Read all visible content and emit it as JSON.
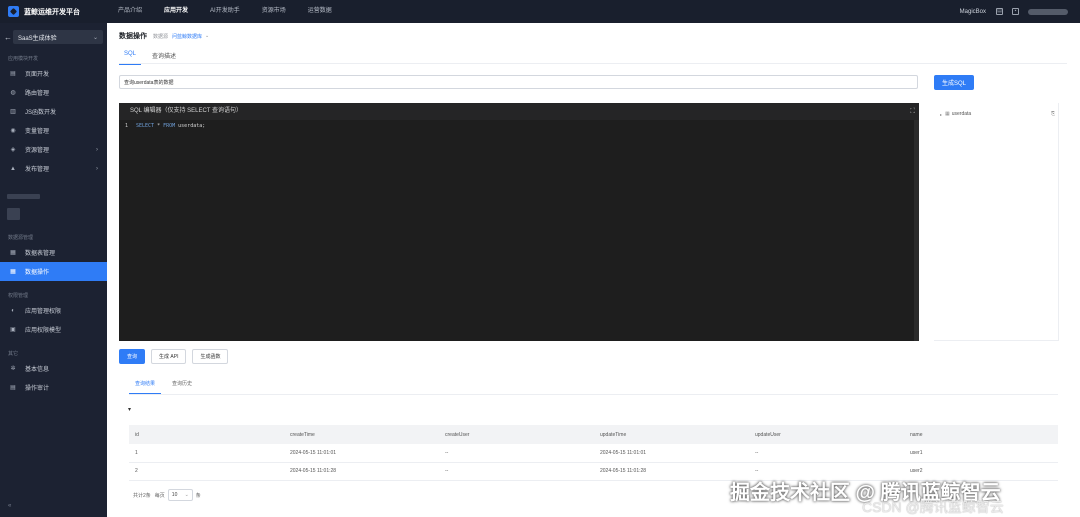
{
  "topbar": {
    "logo_text": "蓝鲸运维开发平台",
    "nav": [
      "产品介绍",
      "应用开发",
      "AI开发助手",
      "资源市场",
      "运营数据"
    ],
    "active_nav": 1,
    "brand": "MagicBox"
  },
  "sidebar": {
    "app_name": "SaaS生成体验",
    "group1_title": "应用模块开发",
    "group1_items": [
      "页面开发",
      "路由管理",
      "JS函数开发",
      "变量管理",
      "资源管理",
      "发布管理"
    ],
    "group2_title": "数据源管理",
    "group2_items": [
      "数据表管理",
      "数据操作"
    ],
    "group3_title": "权限管理",
    "group3_items": [
      "应用管理权限",
      "应用权限模型"
    ],
    "group4_title": "其它",
    "group4_items": [
      "基本信息",
      "操作审计"
    ],
    "collapse": "«"
  },
  "page": {
    "title": "数据操作",
    "crumb": "数据源",
    "crumb_link": "问蓝鲸数据库"
  },
  "tabs": [
    "SQL",
    "查询描述"
  ],
  "nl_query": "查询userdata表的数据",
  "generate_sql": "生成SQL",
  "editor": {
    "header": "SQL 编辑器（仅支持 SELECT 查询语句）",
    "line_no": "1",
    "kw1": "SELECT",
    "star": " * ",
    "kw2": "FROM",
    "rest": " userdata;"
  },
  "schema": {
    "table": "userdata"
  },
  "buttons": {
    "query": "查询",
    "gen_api": "生成 API",
    "gen_func": "生成函数"
  },
  "result_tabs": [
    "查询结果",
    "查询历史"
  ],
  "table": {
    "columns": [
      "id",
      "createTime",
      "createUser",
      "updateTime",
      "updateUser",
      "name"
    ],
    "rows": [
      [
        "1",
        "2024-05-15 11:01:01",
        "--",
        "2024-05-15 11:01:01",
        "--",
        "user1"
      ],
      [
        "2",
        "2024-05-15 11:01:28",
        "--",
        "2024-05-15 11:01:28",
        "--",
        "user2"
      ]
    ]
  },
  "pager": {
    "total": "共计2条",
    "per_page_label": "每页",
    "page_size": "10",
    "unit": "条"
  },
  "watermark": {
    "main": "掘金技术社区 @ 腾讯蓝鲸智云",
    "sub": "CSDN @腾讯蓝鲸智云"
  }
}
